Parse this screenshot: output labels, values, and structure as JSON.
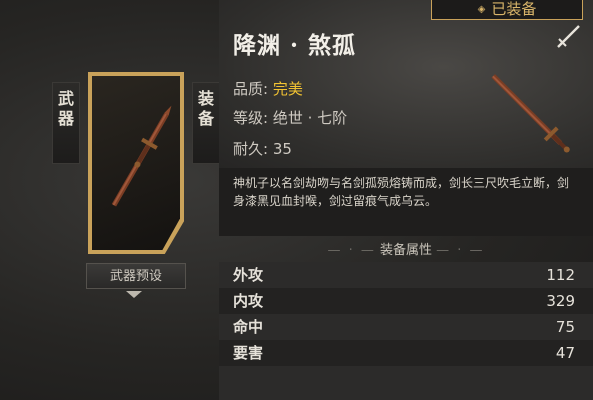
{
  "left": {
    "tab_weapon": [
      "武",
      "器"
    ],
    "tab_equip": [
      "装",
      "备"
    ],
    "preset_label": "武器预设"
  },
  "item": {
    "equipped_label": "已装备",
    "name": "降渊 · 煞孤",
    "quality_label": "品质:",
    "quality_value": "完美",
    "grade_label": "等级:",
    "grade_value": "绝世 · 七阶",
    "durability_label": "耐久:",
    "durability_value": "35",
    "description": "神机子以名剑劫吻与名剑孤殒熔铸而成，剑长三尺吹毛立断，剑身漆黑见血封喉，剑过留痕气成乌云。"
  },
  "attributes": {
    "header": "装备属性",
    "rows": [
      {
        "name": "外攻",
        "value": "112"
      },
      {
        "name": "内攻",
        "value": "329"
      },
      {
        "name": "命中",
        "value": "75"
      },
      {
        "name": "要害",
        "value": "47"
      }
    ]
  },
  "colors": {
    "gold": "#c9a25a",
    "quality": "#f1c232"
  },
  "icons": {
    "equipped": "diamond-icon",
    "compare": "sword-icon",
    "preset_toggle": "chevron-down-icon"
  }
}
